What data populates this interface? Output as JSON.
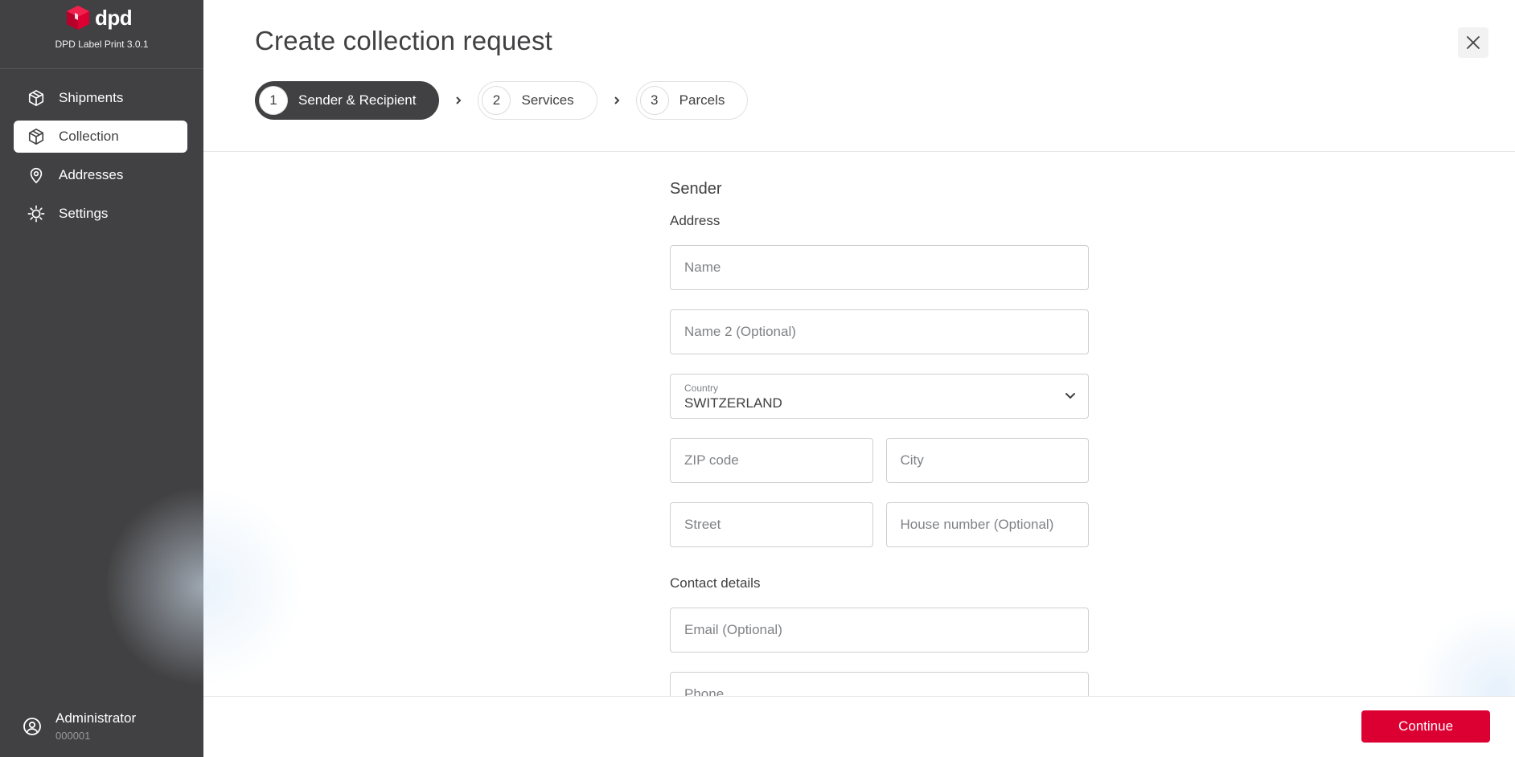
{
  "brand": {
    "logo_text": "dpd",
    "version": "DPD Label Print 3.0.1",
    "accent_color": "#dc0032"
  },
  "sidebar": {
    "items": [
      {
        "label": "Shipments",
        "icon": "package-icon",
        "active": false
      },
      {
        "label": "Collection",
        "icon": "package-icon",
        "active": true
      },
      {
        "label": "Addresses",
        "icon": "location-pin-icon",
        "active": false
      },
      {
        "label": "Settings",
        "icon": "gear-icon",
        "active": false
      }
    ],
    "user": {
      "name": "Administrator",
      "id": "000001",
      "icon": "user-circle-icon"
    }
  },
  "header": {
    "title": "Create collection request",
    "close_icon": "close-icon"
  },
  "stepper": {
    "steps": [
      {
        "number": "1",
        "label": "Sender & Recipient",
        "active": true
      },
      {
        "number": "2",
        "label": "Services",
        "active": false
      },
      {
        "number": "3",
        "label": "Parcels",
        "active": false
      }
    ],
    "separator_icon": "chevron-right-icon"
  },
  "form": {
    "section_title": "Sender",
    "address_heading": "Address",
    "name_placeholder": "Name",
    "name2_placeholder": "Name 2 (Optional)",
    "country": {
      "label": "Country",
      "value": "SWITZERLAND",
      "icon": "chevron-down-icon"
    },
    "zip_placeholder": "ZIP code",
    "city_placeholder": "City",
    "street_placeholder": "Street",
    "house_number_placeholder": "House number (Optional)",
    "contact_heading": "Contact details",
    "email_placeholder": "Email (Optional)",
    "phone_placeholder": "Phone"
  },
  "footer": {
    "continue_label": "Continue"
  }
}
